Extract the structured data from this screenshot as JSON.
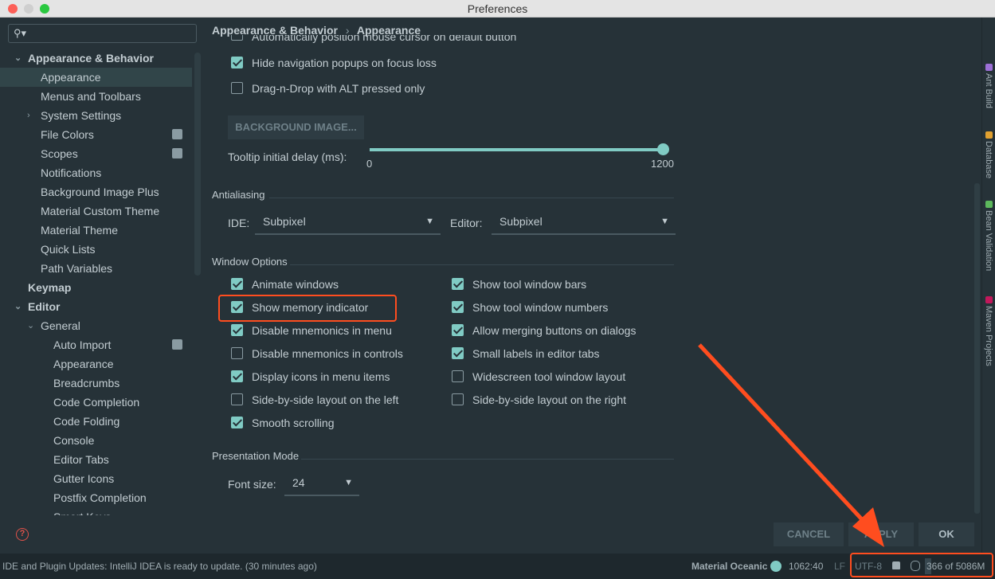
{
  "window": {
    "title": "Preferences"
  },
  "sidebar": {
    "search_placeholder": "",
    "items": [
      {
        "label": "Appearance & Behavior",
        "level": 0,
        "arrow": "expanded",
        "bold": true
      },
      {
        "label": "Appearance",
        "level": 1,
        "selected": true
      },
      {
        "label": "Menus and Toolbars",
        "level": 1
      },
      {
        "label": "System Settings",
        "level": 1,
        "arrow": "collapsed"
      },
      {
        "label": "File Colors",
        "level": 1,
        "badge": true
      },
      {
        "label": "Scopes",
        "level": 1,
        "badge": true
      },
      {
        "label": "Notifications",
        "level": 1
      },
      {
        "label": "Background Image Plus",
        "level": 1
      },
      {
        "label": "Material Custom Theme",
        "level": 1
      },
      {
        "label": "Material Theme",
        "level": 1
      },
      {
        "label": "Quick Lists",
        "level": 1
      },
      {
        "label": "Path Variables",
        "level": 1
      },
      {
        "label": "Keymap",
        "level": 0,
        "bold": true
      },
      {
        "label": "Editor",
        "level": 0,
        "arrow": "expanded",
        "bold": true
      },
      {
        "label": "General",
        "level": 1,
        "arrow": "expanded"
      },
      {
        "label": "Auto Import",
        "level": 2,
        "badge": true
      },
      {
        "label": "Appearance",
        "level": 2
      },
      {
        "label": "Breadcrumbs",
        "level": 2
      },
      {
        "label": "Code Completion",
        "level": 2
      },
      {
        "label": "Code Folding",
        "level": 2
      },
      {
        "label": "Console",
        "level": 2
      },
      {
        "label": "Editor Tabs",
        "level": 2
      },
      {
        "label": "Gutter Icons",
        "level": 2
      },
      {
        "label": "Postfix Completion",
        "level": 2
      },
      {
        "label": "Smart Keys",
        "level": 2
      }
    ]
  },
  "breadcrumb": {
    "parent": "Appearance & Behavior",
    "separator": "›",
    "current": "Appearance"
  },
  "top_options": [
    {
      "label": "Automatically position mouse cursor on default button",
      "checked": false
    },
    {
      "label": "Hide navigation popups on focus loss",
      "checked": true
    },
    {
      "label": "Drag-n-Drop with ALT pressed only",
      "checked": false
    }
  ],
  "background_image_button": "BACKGROUND IMAGE...",
  "tooltip": {
    "label": "Tooltip initial delay (ms):",
    "min": "0",
    "max": "1200",
    "value": 1200
  },
  "antialiasing": {
    "title": "Antialiasing",
    "ide_label": "IDE:",
    "ide_value": "Subpixel",
    "editor_label": "Editor:",
    "editor_value": "Subpixel"
  },
  "window_options": {
    "title": "Window Options",
    "left": [
      {
        "label": "Animate windows",
        "checked": true
      },
      {
        "label": "Show memory indicator",
        "checked": true,
        "highlighted": true
      },
      {
        "label": "Disable mnemonics in menu",
        "checked": true
      },
      {
        "label": "Disable mnemonics in controls",
        "checked": false
      },
      {
        "label": "Display icons in menu items",
        "checked": true
      },
      {
        "label": "Side-by-side layout on the left",
        "checked": false
      },
      {
        "label": "Smooth scrolling",
        "checked": true
      }
    ],
    "right": [
      {
        "label": "Show tool window bars",
        "checked": true
      },
      {
        "label": "Show tool window numbers",
        "checked": true
      },
      {
        "label": "Allow merging buttons on dialogs",
        "checked": true
      },
      {
        "label": "Small labels in editor tabs",
        "checked": true
      },
      {
        "label": "Widescreen tool window layout",
        "checked": false
      },
      {
        "label": "Side-by-side layout on the right",
        "checked": false
      }
    ]
  },
  "presentation": {
    "title": "Presentation Mode",
    "font_label": "Font size:",
    "font_value": "24"
  },
  "buttons": {
    "cancel": "CANCEL",
    "apply": "APPLY",
    "ok": "OK"
  },
  "tool_windows": [
    {
      "label": "Ant Build",
      "color": "#9c6fd6"
    },
    {
      "label": "Database",
      "color": "#e0a030"
    },
    {
      "label": "Bean Validation",
      "color": "#5cb85c"
    },
    {
      "label": "Maven Projects",
      "color": "#c2185b"
    }
  ],
  "status": {
    "message": "IDE and Plugin Updates: IntelliJ IDEA is ready to update. (30 minutes ago)",
    "theme": "Material Oceanic",
    "position": "1062:40",
    "line_sep": "LF",
    "encoding": "UTF-8",
    "memory": "366 of 5086M"
  },
  "colors": {
    "accent": "#80cbc4",
    "highlight": "#ff4d1f",
    "background": "#263238"
  }
}
